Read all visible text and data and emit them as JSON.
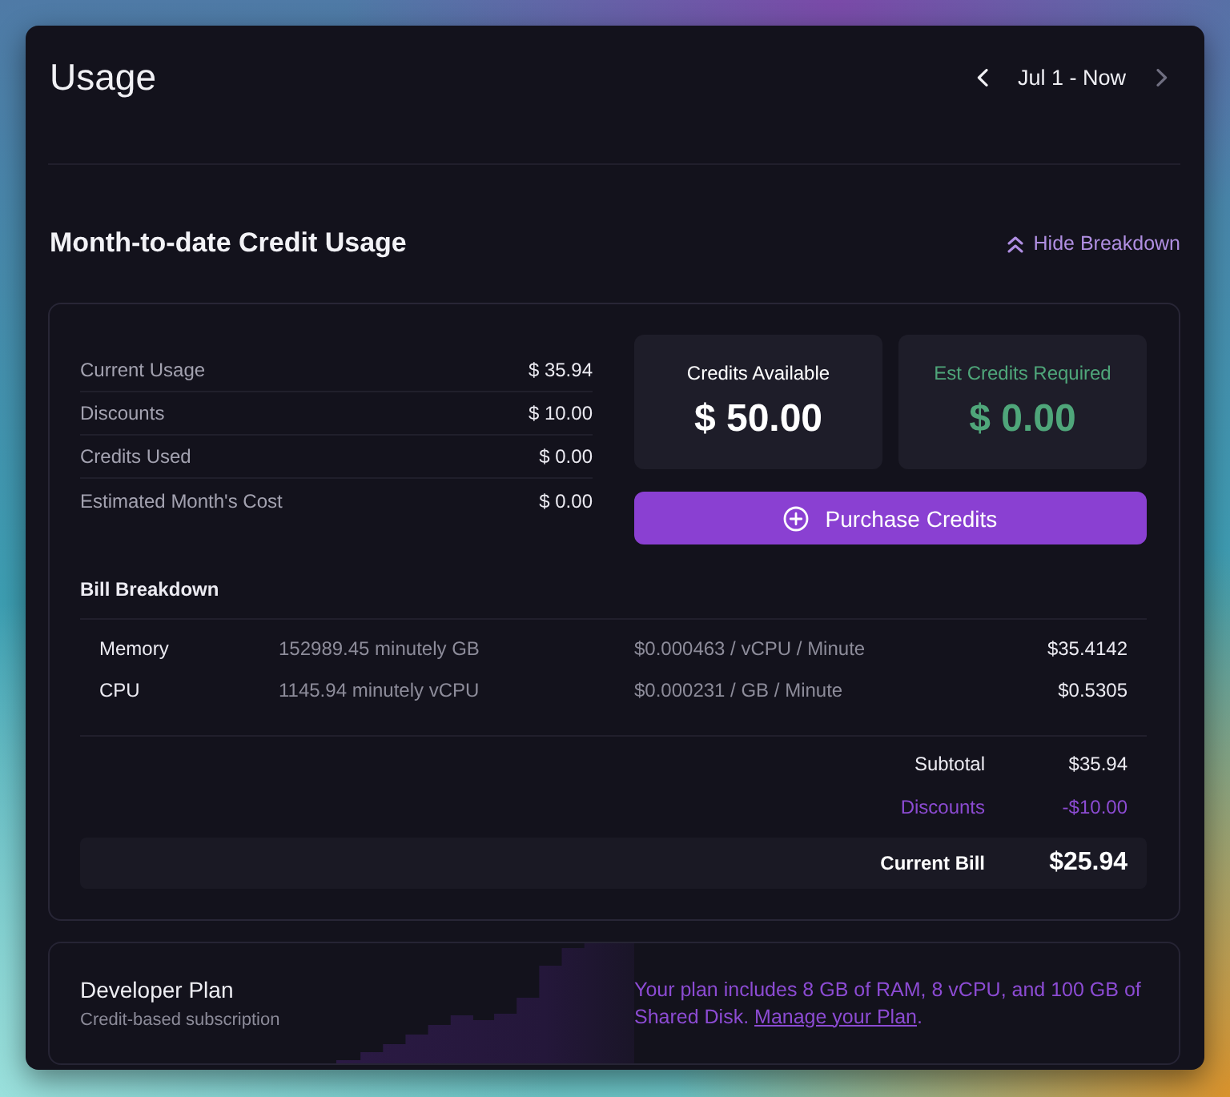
{
  "header": {
    "title": "Usage",
    "previous": {
      "disabled": false
    },
    "date_range": "Jul 1 - Now",
    "next": {
      "disabled": true
    }
  },
  "section": {
    "title": "Month-to-date Credit Usage",
    "toggle": {
      "label": "Hide Breakdown",
      "expanded": true
    }
  },
  "usage_summary": [
    {
      "label": "Current Usage",
      "value": "$ 35.94"
    },
    {
      "label": "Discounts",
      "value": "$ 10.00"
    },
    {
      "label": "Credits Used",
      "value": "$ 0.00"
    },
    {
      "label": "Estimated Month's Cost",
      "value": "$ 0.00"
    }
  ],
  "credit_cards": [
    {
      "title": "Credits Available",
      "value": "$ 50.00",
      "color": "#ffffff"
    },
    {
      "title": "Est Credits Required",
      "value": "$ 0.00",
      "color": "#4fa67a"
    }
  ],
  "purchase_button": {
    "label": "Purchase Credits"
  },
  "breakdown": {
    "title": "Bill Breakdown",
    "rows": [
      {
        "resource": "Memory",
        "quantity": "152989.45 minutely GB",
        "rate": "$0.000463 / vCPU / Minute",
        "amount": "$35.4142"
      },
      {
        "resource": "CPU",
        "quantity": "1145.94 minutely vCPU",
        "rate": "$0.000231 / GB / Minute",
        "amount": "$0.5305"
      }
    ],
    "totals": [
      {
        "kind": "plain",
        "label": "Subtotal",
        "value": "$35.94"
      },
      {
        "kind": "discount",
        "label": "Discounts",
        "value": "-$10.00"
      },
      {
        "kind": "total",
        "label": "Current Bill",
        "value": "$25.94"
      }
    ]
  },
  "plan": {
    "name": "Developer Plan",
    "subtitle": "Credit-based subscription",
    "description": "Your plan includes 8 GB of RAM, 8 vCPU, and 100 GB of Shared Disk.",
    "link": "Manage your Plan",
    "link_suffix": "."
  }
}
